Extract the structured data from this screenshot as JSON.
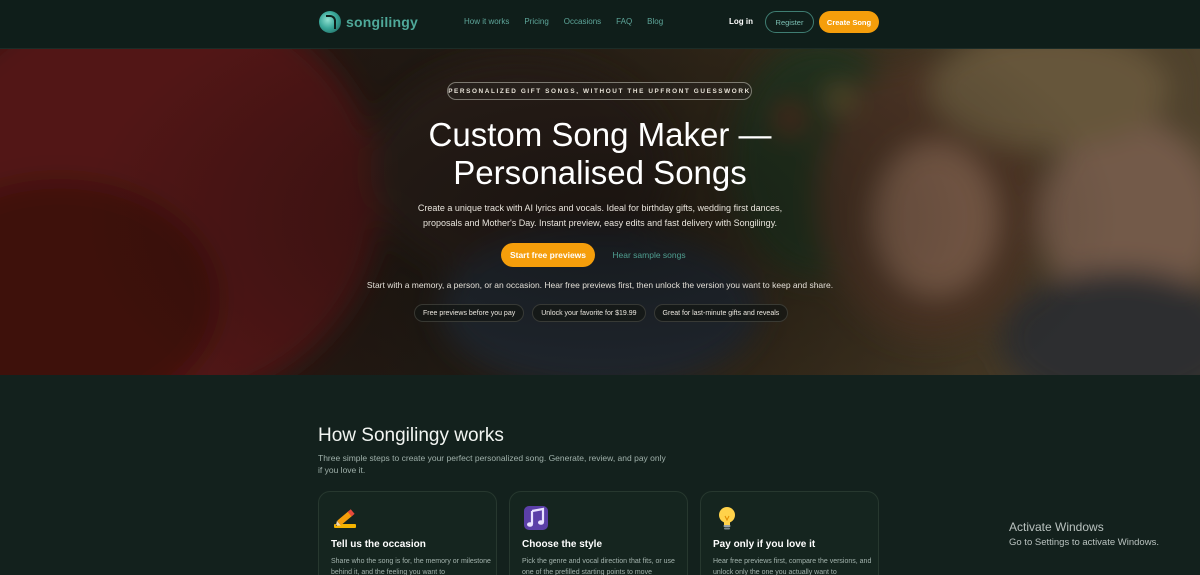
{
  "nav": {
    "brand": "songilingy",
    "links": [
      "How it works",
      "Pricing",
      "Occasions",
      "FAQ",
      "Blog"
    ],
    "login": "Log in",
    "register": "Register",
    "create": "Create Song"
  },
  "hero": {
    "eyebrow": "PERSONALIZED GIFT SONGS, WITHOUT THE UPFRONT GUESSWORK",
    "title_line1": "Custom Song Maker —",
    "title_line2": "Personalised Songs",
    "description": "Create a unique track with AI lyrics and vocals. Ideal for birthday gifts, wedding first dances, proposals and Mother's Day. Instant preview, easy edits and fast delivery with Songilingy.",
    "primary_cta": "Start free previews",
    "secondary_cta": "Hear sample songs",
    "subtext": "Start with a memory, a person, or an occasion. Hear free previews first, then unlock the version you want to keep and share.",
    "chips": [
      "Free previews before you pay",
      "Unlock your favorite for $19.99",
      "Great for last-minute gifts and reveals"
    ]
  },
  "how": {
    "title": "How Songilingy works",
    "subtitle": "Three simple steps to create your perfect personalized song. Generate, review, and pay only if you love it.",
    "cards": [
      {
        "icon": "pencil-icon",
        "title": "Tell us the occasion",
        "text": "Share who the song is for, the memory or milestone behind it, and the feeling you want to"
      },
      {
        "icon": "music-notes-icon",
        "title": "Choose the style",
        "text": "Pick the genre and vocal direction that fits, or use one of the prefilled starting points to move"
      },
      {
        "icon": "lightbulb-icon",
        "title": "Pay only if you love it",
        "text": "Hear free previews first, compare the versions, and unlock only the one you actually want to"
      }
    ]
  },
  "watermark": {
    "line1": "Activate Windows",
    "line2": "Go to Settings to activate Windows."
  },
  "colors": {
    "accent": "#f59e0b",
    "teal": "#4fa99a",
    "background": "#13211d"
  }
}
